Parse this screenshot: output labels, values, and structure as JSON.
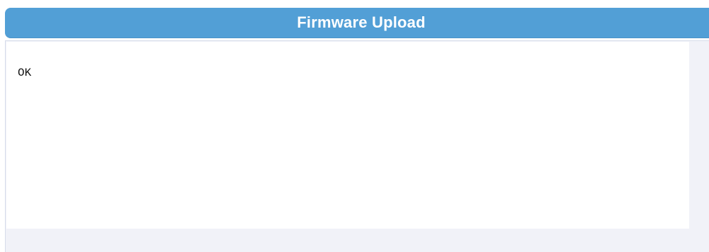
{
  "panel": {
    "title": "Firmware Upload",
    "output": "OK"
  },
  "colors": {
    "header": "#529fd6",
    "header_text": "#ffffff",
    "body_background": "#f1f2f8",
    "output_background": "#ffffff"
  }
}
